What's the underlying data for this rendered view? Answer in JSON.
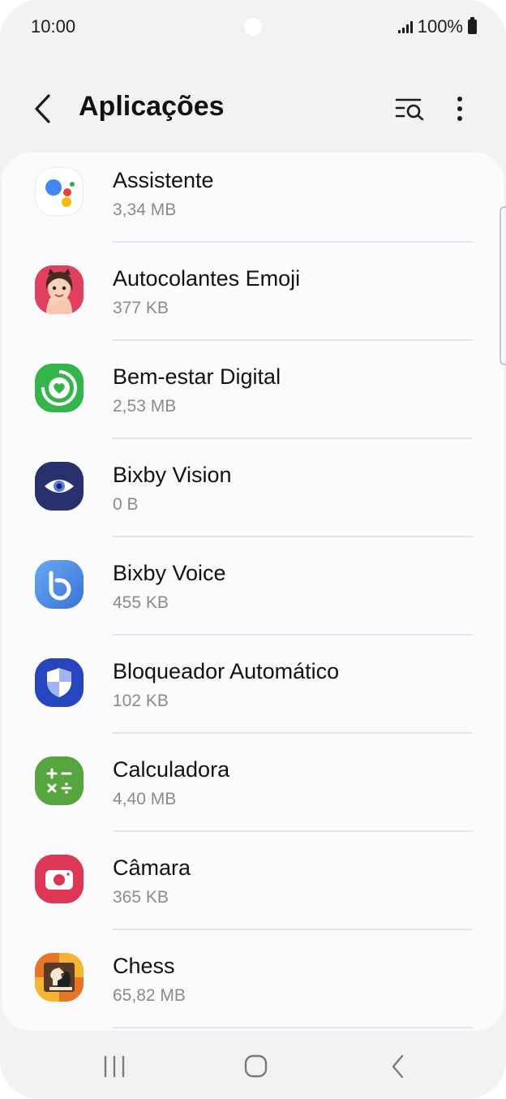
{
  "status_bar": {
    "time": "10:00",
    "battery": "100%"
  },
  "header": {
    "title": "Aplicações"
  },
  "apps": [
    {
      "name": "Assistente",
      "size": "3,34 MB",
      "icon": "google-assistant-icon"
    },
    {
      "name": "Autocolantes Emoji",
      "size": "377 KB",
      "icon": "ar-emoji-stickers-icon"
    },
    {
      "name": "Bem-estar Digital",
      "size": "2,53 MB",
      "icon": "digital-wellbeing-icon"
    },
    {
      "name": "Bixby Vision",
      "size": "0 B",
      "icon": "bixby-vision-icon"
    },
    {
      "name": "Bixby Voice",
      "size": "455 KB",
      "icon": "bixby-voice-icon"
    },
    {
      "name": "Bloqueador Automático",
      "size": "102 KB",
      "icon": "auto-blocker-shield-icon"
    },
    {
      "name": "Calculadora",
      "size": "4,40 MB",
      "icon": "calculator-icon"
    },
    {
      "name": "Câmara",
      "size": "365 KB",
      "icon": "camera-icon"
    },
    {
      "name": "Chess",
      "size": "65,82 MB",
      "icon": "chess-icon"
    }
  ],
  "colors": {
    "background": "#f2f2f5",
    "card": "#fbfbfd",
    "text_primary": "#121212",
    "text_secondary": "#8b8b8b"
  }
}
